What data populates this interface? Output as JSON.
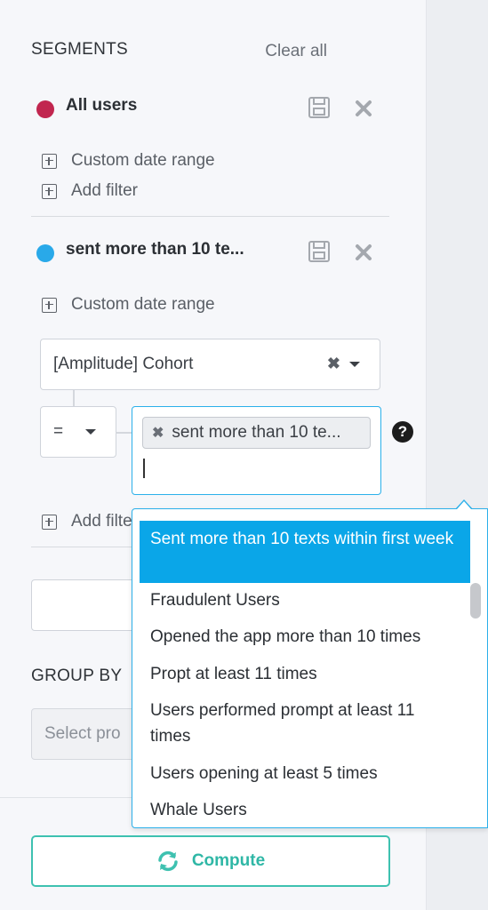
{
  "segments": {
    "title": "SEGMENTS",
    "clear_all": "Clear all",
    "items": [
      {
        "name": "All users",
        "color": "#c1264f",
        "custom_date_range": "Custom date range",
        "add_filter": "Add filter"
      },
      {
        "name": "sent more than 10 te...",
        "color": "#29a9e9",
        "custom_date_range": "Custom date range",
        "add_filter": "Add filte"
      }
    ],
    "filter": {
      "property": "[Amplitude] Cohort",
      "operator": "=",
      "selected_value": "sent more than 10 te..."
    }
  },
  "dropdown": {
    "options": [
      "Sent more than 10 texts within first week",
      "Fraudulent Users",
      "Opened the app more than 10 times",
      "Propt at least 11 times",
      "Users performed prompt at least 11 times",
      "Users opening at least 5 times",
      "Whale Users"
    ],
    "highlighted_index": 0
  },
  "group_by": {
    "title": "GROUP BY",
    "placeholder": "Select pro"
  },
  "compute_label": "Compute",
  "colors": {
    "accent": "#0aa6e8",
    "compute": "#3ec1b0"
  }
}
